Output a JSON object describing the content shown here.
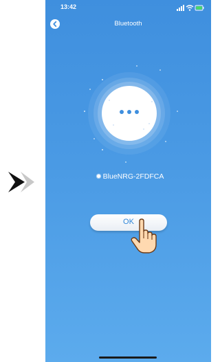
{
  "status_bar": {
    "time": "13:42"
  },
  "header": {
    "title": "Bluetooth",
    "back_icon": "chevron-left-icon"
  },
  "scan": {
    "state_icon": "ellipsis-icon"
  },
  "device": {
    "name": "BlueNRG-2FDFCA",
    "selected": true
  },
  "ok_button": {
    "label": "OK"
  },
  "colors": {
    "background_top": "#3f8fde",
    "background_bottom": "#5cabed",
    "accent": "#2f86d9",
    "arrow_dark": "#111111",
    "arrow_light": "#c8c8c8"
  }
}
